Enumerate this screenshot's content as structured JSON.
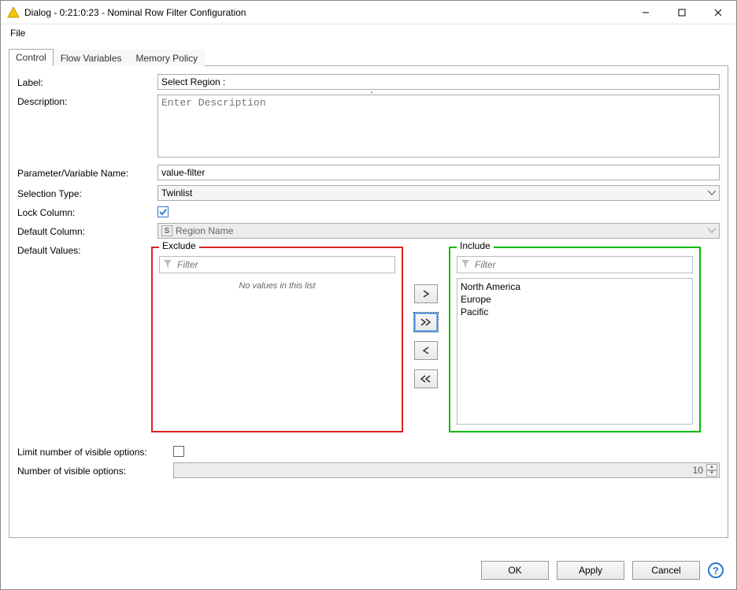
{
  "window": {
    "title": "Dialog - 0:21:0:23 - Nominal Row Filter Configuration"
  },
  "menubar": {
    "file": "File"
  },
  "tabs": {
    "control": "Control",
    "flow_variables": "Flow Variables",
    "memory_policy": "Memory Policy"
  },
  "labels": {
    "label": "Label:",
    "description": "Description:",
    "param_name": "Parameter/Variable Name:",
    "selection_type": "Selection Type:",
    "lock_column": "Lock Column:",
    "default_column": "Default Column:",
    "default_values": "Default Values:",
    "limit_visible": "Limit number of visible options:",
    "number_visible": "Number of visible options:"
  },
  "fields": {
    "label_value": "Select Region :",
    "description_placeholder": "Enter Description",
    "param_value": "value-filter",
    "selection_type_value": "Twinlist",
    "default_column_value": "Region Name",
    "default_column_type": "S",
    "number_visible_value": "10"
  },
  "twin": {
    "exclude_title": "Exclude",
    "include_title": "Include",
    "filter_placeholder": "Filter",
    "exclude_empty": "No values in this list",
    "include_items": [
      "North America",
      "Europe",
      "Pacific"
    ]
  },
  "buttons": {
    "ok": "OK",
    "apply": "Apply",
    "cancel": "Cancel"
  }
}
